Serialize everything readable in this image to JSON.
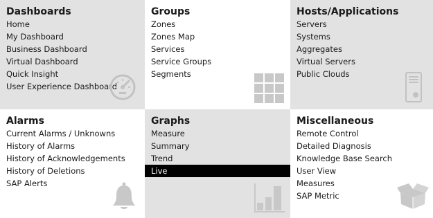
{
  "tiles": [
    {
      "title": "Dashboards",
      "items": [
        "Home",
        "My Dashboard",
        "Business Dashboard",
        "Virtual Dashboard",
        "Quick Insight",
        "User Experience Dashboard"
      ],
      "icon": "gauge-icon"
    },
    {
      "title": "Groups",
      "items": [
        "Zones",
        "Zones Map",
        "Services",
        "Service Groups",
        "Segments"
      ],
      "icon": "grid-icon"
    },
    {
      "title": "Hosts/Applications",
      "items": [
        "Servers",
        "Systems",
        "Aggregates",
        "Virtual Servers",
        "Public Clouds"
      ],
      "icon": "server-icon"
    },
    {
      "title": "Alarms",
      "items": [
        "Current Alarms / Unknowns",
        "History of Alarms",
        "History of Acknowledgements",
        "History of Deletions",
        "SAP Alerts"
      ],
      "icon": "bell-icon"
    },
    {
      "title": "Graphs",
      "items": [
        "Measure",
        "Summary",
        "Trend",
        "Live"
      ],
      "active_item": "Live",
      "icon": "bar-chart-icon"
    },
    {
      "title": "Miscellaneous",
      "items": [
        "Remote Control",
        "Detailed Diagnosis",
        "Knowledge Base Search",
        "User View",
        "Measures",
        "SAP Metric"
      ],
      "icon": "box-icon"
    }
  ],
  "colors": {
    "tile_gray": "#e2e2e2",
    "tile_white": "#ffffff",
    "active_bg": "#000000",
    "active_fg": "#ffffff",
    "icon_gray": "#c2c2c2"
  }
}
